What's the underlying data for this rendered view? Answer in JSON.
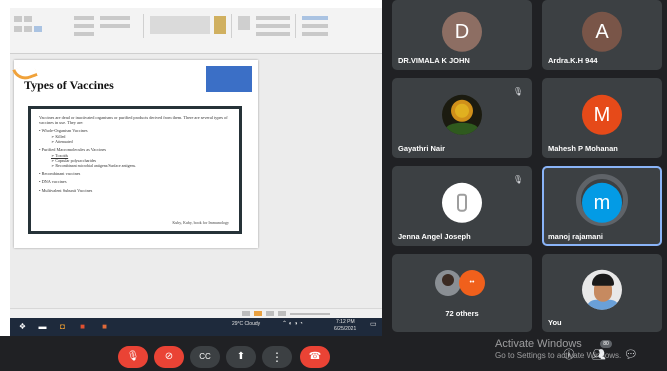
{
  "slide": {
    "title": "Types of Vaccines",
    "intro": "Vaccines are dead or inactivated organisms or purified products derived from them. There are several types of vaccines in use. They are:",
    "items": [
      {
        "text": "Whole-Organism Vaccines",
        "subs": [
          "Killed",
          "Attenuated"
        ],
        "underline": false
      },
      {
        "text": "Purified Macromolecules as Vaccines",
        "subs": [
          "Toxoids",
          "Capsular polysaccharides",
          "Recombinant microbial antigens/Surface antigens."
        ],
        "underline": true
      },
      {
        "text": "Recombinant vaccines",
        "subs": [],
        "underline": false
      },
      {
        "text": "DNA vaccines",
        "subs": [],
        "underline": false
      },
      {
        "text": "Multivalent Subunit Vaccines",
        "subs": [],
        "underline": false
      }
    ],
    "credit": "Kuby, Kuby, book for Immunology",
    "colors": {
      "accent": "#f0a23a",
      "title_block": "#3b6fc6",
      "frame": "#263238"
    }
  },
  "taskbar": {
    "weather": "29°C Cloudy",
    "time": "7:12 PM",
    "date": "6/25/2021"
  },
  "participants": [
    {
      "name": "DR.VIMALA K JOHN",
      "initial": "D",
      "color": "#8d6e63",
      "type": "initial",
      "muted": false
    },
    {
      "name": "Ardra.K.H 944",
      "initial": "A",
      "color": "#795548",
      "type": "initial",
      "muted": false
    },
    {
      "name": "Gayathri Nair",
      "type": "flower",
      "muted": true
    },
    {
      "name": "Mahesh P Mohanan",
      "initial": "M",
      "color": "#e64a19",
      "type": "initial",
      "muted": false
    },
    {
      "name": "Jenna Angel Joseph",
      "type": "bottle",
      "muted": true
    },
    {
      "name": "manoj rajamani",
      "initial": "m",
      "color": "#039be5",
      "type": "initial",
      "muted": false,
      "active": true
    },
    {
      "name": "72 others",
      "type": "others",
      "muted": false
    },
    {
      "name": "You",
      "type": "photo",
      "muted": false
    }
  ],
  "controls": {
    "mic": "mic-off-icon",
    "camera": "camera-off-icon",
    "captions": "CC",
    "present": "present-icon",
    "more": "⋮",
    "end": "end-call-icon",
    "participant_count": "80"
  },
  "watermark": {
    "line1": "Activate Windows",
    "line2": "Go to Settings to activate Windows."
  }
}
